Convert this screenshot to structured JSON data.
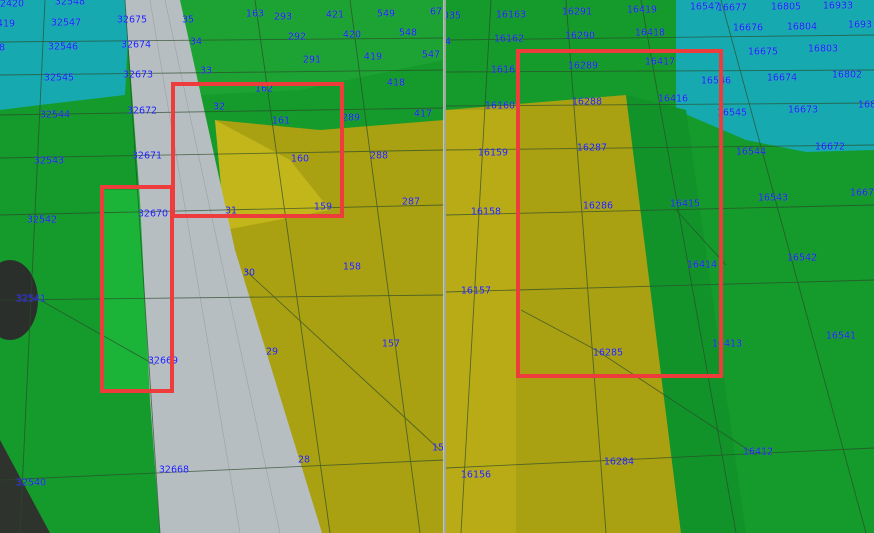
{
  "colors": {
    "highlight": "#ee3b3b",
    "label_text": "#1a1aff",
    "grass": "#159a2c",
    "grass_light": "#1fb23a",
    "sand": "#a9a012",
    "sand_light": "#c3b61a",
    "water": "#17a9b0",
    "road": "#b7bec2",
    "wireframe": "#2a4a2a"
  },
  "left_panel": {
    "labels": {
      "v32420": "2420",
      "v32548": "32548",
      "v32675": "32675",
      "v32547": "32547",
      "v32546": "32546",
      "v32545": "32545",
      "v32544": "32544",
      "v32543": "32543",
      "v32542": "32542",
      "v32541": "32541",
      "v32540": "32540",
      "v419": "419",
      "v8": "8",
      "v32674": "32674",
      "v32673": "32673",
      "v32672": "32672",
      "v32671": "32671",
      "v32670": "32670",
      "v32669": "32669",
      "v32668": "32668",
      "v35": "35",
      "v34": "34",
      "v33": "33",
      "v32": "32",
      "v31": "31",
      "v30": "30",
      "v29": "29",
      "v28": "28",
      "v163": "163",
      "v162": "162",
      "v161": "161",
      "v160": "160",
      "v159": "159",
      "v158": "158",
      "v157": "157",
      "v15": "15",
      "v293": "293",
      "v292": "292",
      "v291": "291",
      "v289": "289",
      "v288": "288",
      "v287": "287",
      "v421": "421",
      "v420": "420",
      "v418": "418",
      "v417": "417",
      "v549": "549",
      "v548": "548",
      "v547": "547",
      "v67": "67"
    }
  },
  "right_panel": {
    "labels": {
      "v035": "035",
      "v4": "4",
      "v16163": "16163",
      "v16162": "16162",
      "v16161": "16161",
      "v16160": "16160",
      "v16159": "16159",
      "v16158": "16158",
      "v16157": "16157",
      "v16156": "16156",
      "v16291": "16291",
      "v16290": "16290",
      "v16289": "16289",
      "v16288": "16288",
      "v16287": "16287",
      "v16286": "16286",
      "v16285": "16285",
      "v16284": "16284",
      "v16419": "16419",
      "v16418": "16418",
      "v16417": "16417",
      "v16416": "16416",
      "v16415": "16415",
      "v16414": "16414",
      "v16413": "16413",
      "v16412": "16412",
      "v16547": "16547",
      "v16546": "16546",
      "v16545": "16545",
      "v16544": "16544",
      "v16543": "16543",
      "v16542": "16542",
      "v16541": "16541",
      "v16677": "16677",
      "v16676": "16676",
      "v16675": "16675",
      "v16674": "16674",
      "v16673": "16673",
      "v16672": "16672",
      "v1667": "1667",
      "v16805": "16805",
      "v16804": "16804",
      "v16803": "16803",
      "v16802": "16802",
      "v16933": "16933",
      "v1693": "1693",
      "v168": "168"
    }
  }
}
